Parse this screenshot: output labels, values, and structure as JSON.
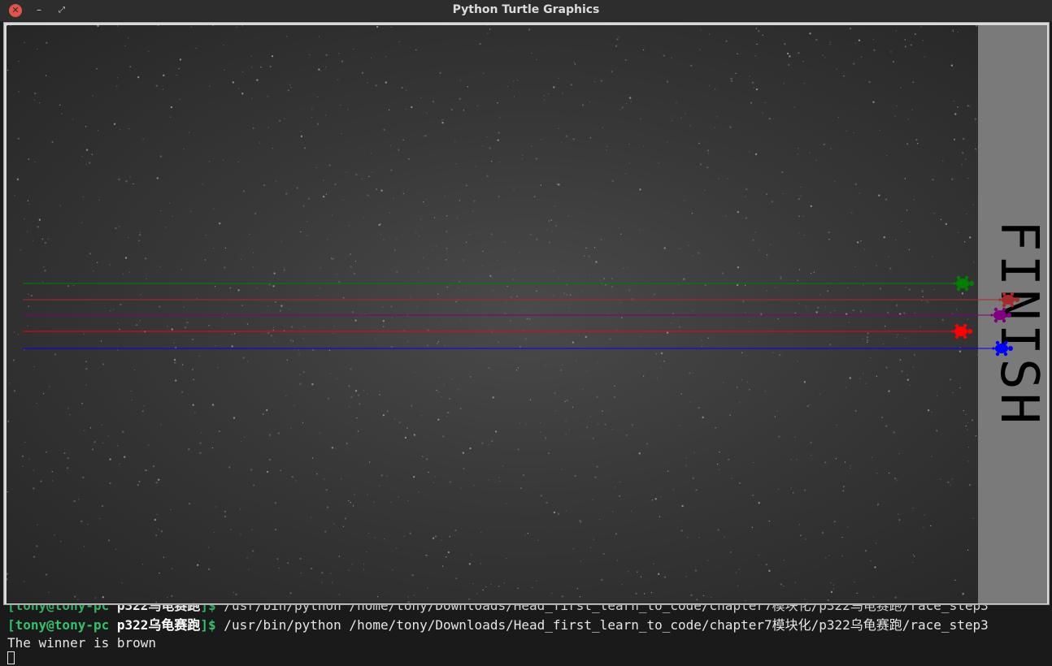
{
  "window": {
    "title": "Python Turtle Graphics",
    "close_icon": "close-icon",
    "minimize_icon": "minimize-icon",
    "maximize_icon": "maximize-icon"
  },
  "canvas": {
    "finish_text": "FINISH",
    "track_color": "#333333",
    "finish_color": "#7a7a7a"
  },
  "turtles": [
    {
      "color": "#008000",
      "name": "green"
    },
    {
      "color": "#a52a2a",
      "name": "brown"
    },
    {
      "color": "#800080",
      "name": "purple"
    },
    {
      "color": "#ff0000",
      "name": "red"
    },
    {
      "color": "#0000ff",
      "name": "blue"
    }
  ],
  "terminal": {
    "prompt_user": "[tony@tony-pc ",
    "prompt_dir": "p322乌龟赛跑",
    "prompt_end": "]$",
    "command": " /usr/bin/python /home/tony/Downloads/Head_first_learn_to_code/chapter7模块化/p322乌龟赛跑/race_step3",
    "output": "The winner is brown"
  }
}
